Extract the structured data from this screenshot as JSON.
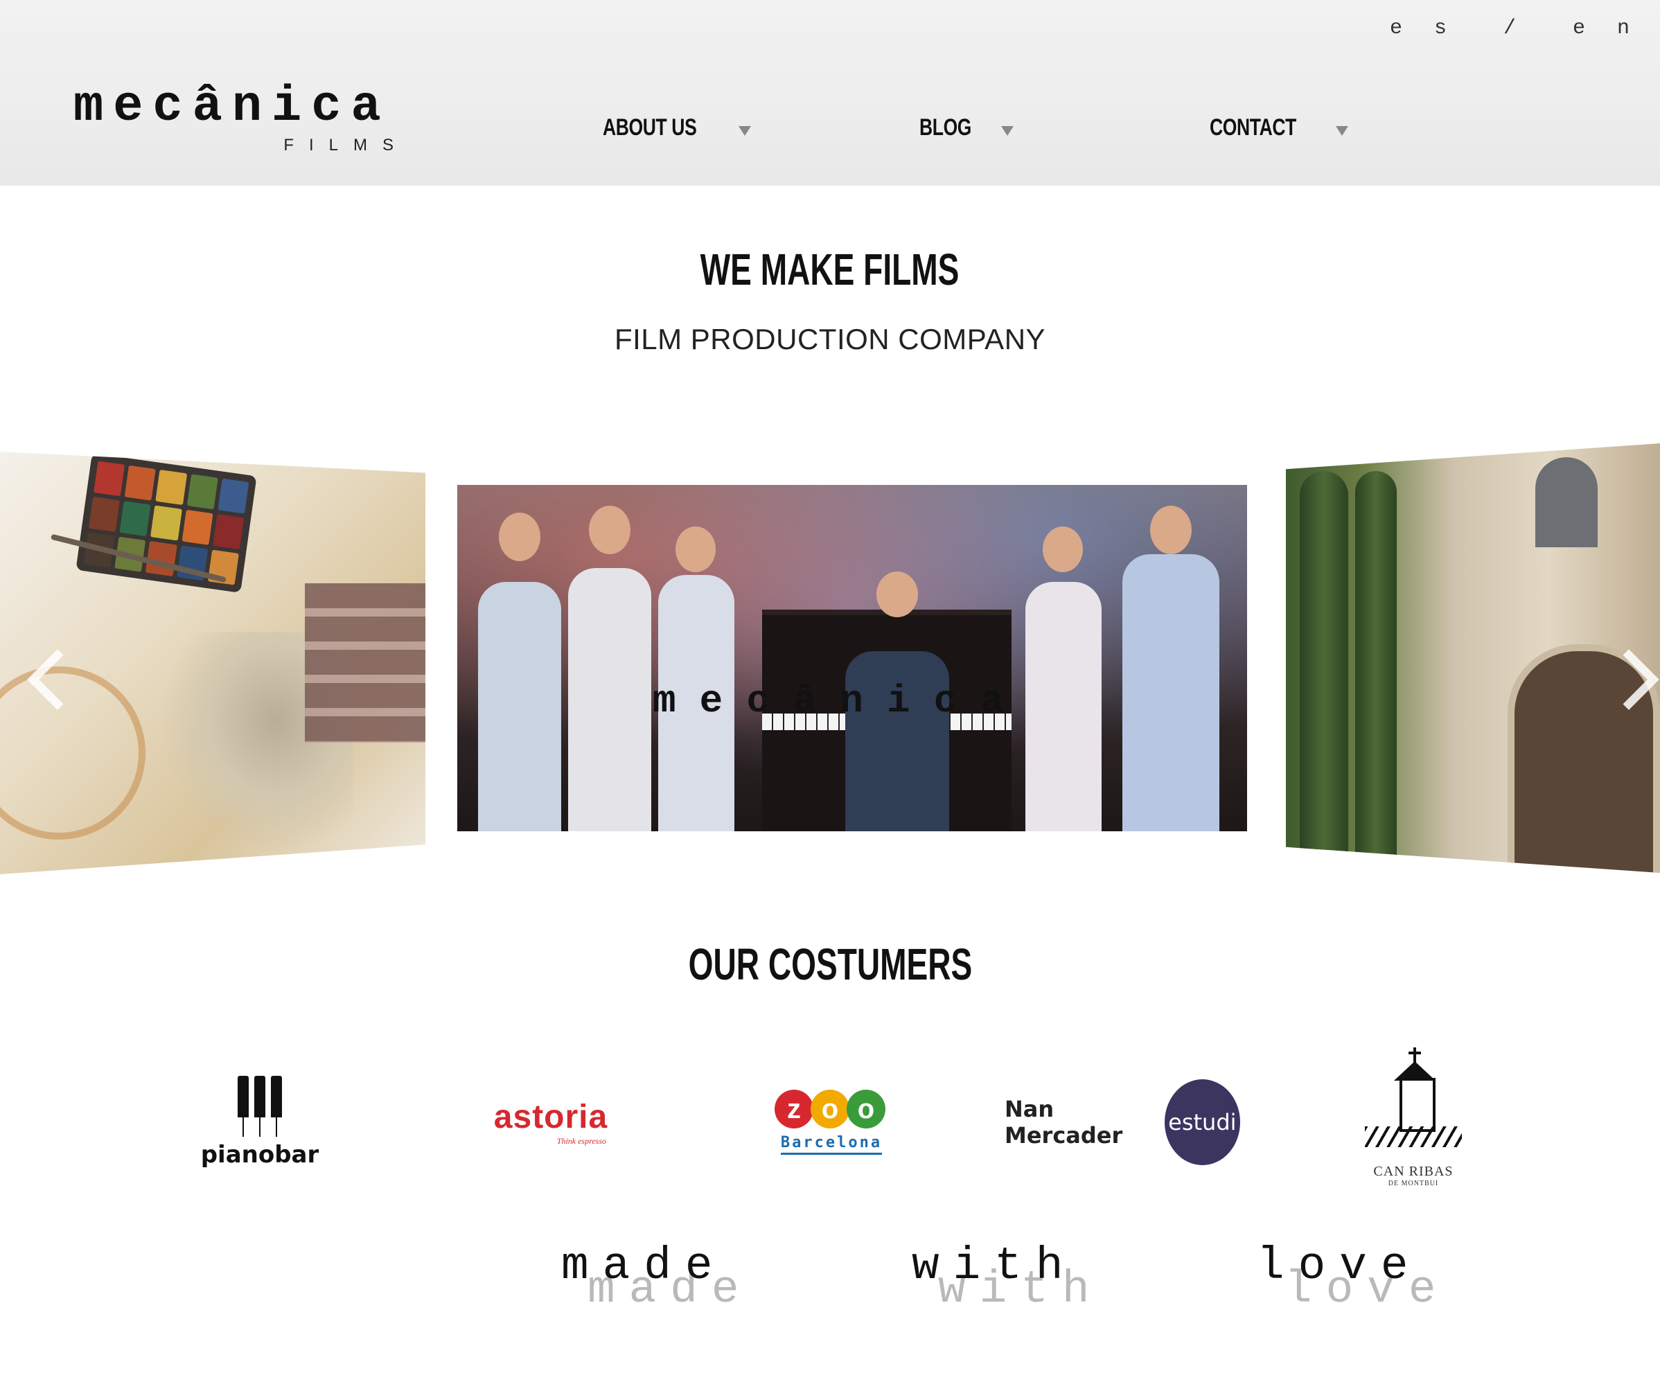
{
  "header": {
    "language": {
      "es": "e s",
      "separator": "/",
      "en": "e n"
    },
    "logo": {
      "main": "mecânica",
      "sub": "FILMS"
    },
    "nav": [
      {
        "label": "ABOUT US"
      },
      {
        "label": "BLOG"
      },
      {
        "label": "CONTACT"
      }
    ]
  },
  "hero": {
    "title": "WE MAKE FILMS",
    "subtitle": "FILM PRODUCTION COMPANY"
  },
  "slider": {
    "watermark": "mecânica",
    "slides": [
      "watercolor-illustration",
      "band-performance",
      "stone-house-courtyard"
    ],
    "icons": {
      "prev": "chevron-left-icon",
      "next": "chevron-right-icon"
    }
  },
  "customers": {
    "title": "OUR COSTUMERS",
    "logos": {
      "pianobar": {
        "name": "pianobar"
      },
      "astoria": {
        "name": "astoria",
        "tagline": "Think espresso"
      },
      "zoo": {
        "letters": [
          "z",
          "o",
          "o"
        ],
        "city": "Barcelona",
        "colors": [
          "#d7282f",
          "#f2a900",
          "#3a9b3a"
        ]
      },
      "nan": {
        "name": "Nan Mercader",
        "badge": "estudi",
        "color": "#3b355f"
      },
      "ribas": {
        "name": "CAN RIBAS",
        "sub": "DE MONTBUI"
      }
    }
  },
  "footer": {
    "words": [
      "made",
      "with",
      "love"
    ],
    "shadow_words": [
      "made",
      "with",
      "love"
    ]
  }
}
